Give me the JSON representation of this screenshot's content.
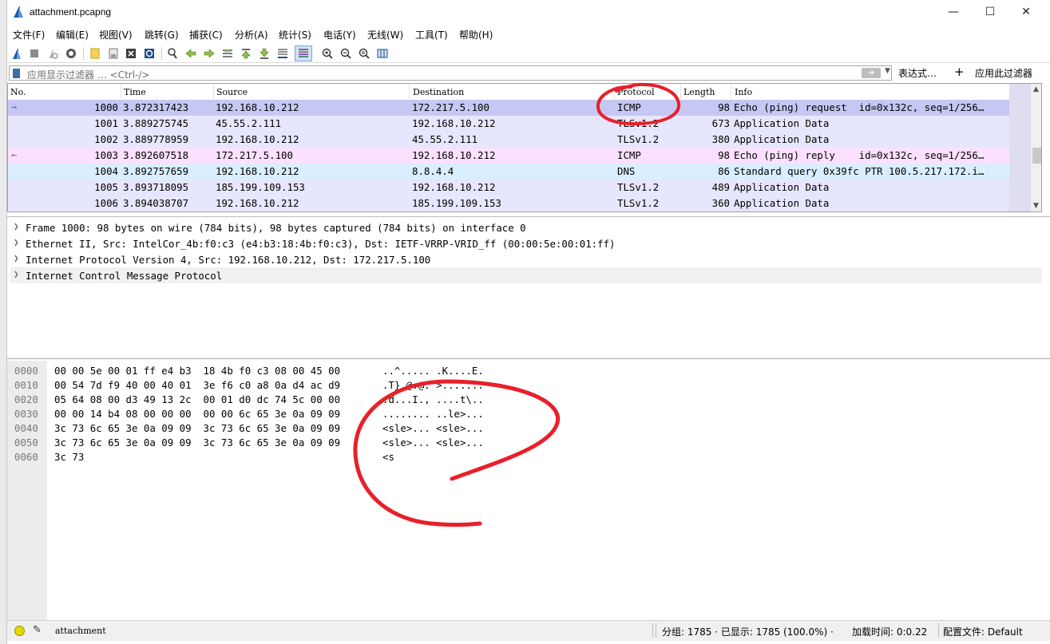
{
  "window": {
    "title": "attachment.pcapng"
  },
  "menu": [
    "文件(F)",
    "编辑(E)",
    "视图(V)",
    "跳转(G)",
    "捕获(C)",
    "分析(A)",
    "统计(S)",
    "电话(Y)",
    "无线(W)",
    "工具(T)",
    "帮助(H)"
  ],
  "filter": {
    "placeholder": "应用显示过滤器 … <Ctrl-/>",
    "expression_label": "表达式…",
    "add_label": "+",
    "apply_label": "应用此过滤器"
  },
  "packet_list": {
    "columns": [
      "No.",
      "Time",
      "Source",
      "Destination",
      "Protocol",
      "Length",
      "Info"
    ],
    "rows": [
      {
        "no": "1000",
        "time": "3.872317423",
        "source": "192.168.10.212",
        "destination": "172.217.5.100",
        "protocol": "ICMP",
        "length": "98",
        "info": "Echo (ping) request  id=0x132c, seq=1/256…",
        "marker": "→"
      },
      {
        "no": "1001",
        "time": "3.889275745",
        "source": "45.55.2.111",
        "destination": "192.168.10.212",
        "protocol": "TLSv1.2",
        "length": "673",
        "info": "Application Data",
        "marker": ""
      },
      {
        "no": "1002",
        "time": "3.889778959",
        "source": "192.168.10.212",
        "destination": "45.55.2.111",
        "protocol": "TLSv1.2",
        "length": "380",
        "info": "Application Data",
        "marker": ""
      },
      {
        "no": "1003",
        "time": "3.892607518",
        "source": "172.217.5.100",
        "destination": "192.168.10.212",
        "protocol": "ICMP",
        "length": "98",
        "info": "Echo (ping) reply    id=0x132c, seq=1/256…",
        "marker": "←"
      },
      {
        "no": "1004",
        "time": "3.892757659",
        "source": "192.168.10.212",
        "destination": "8.8.4.4",
        "protocol": "DNS",
        "length": "86",
        "info": "Standard query 0x39fc PTR 100.5.217.172.i…",
        "marker": ""
      },
      {
        "no": "1005",
        "time": "3.893718095",
        "source": "185.199.109.153",
        "destination": "192.168.10.212",
        "protocol": "TLSv1.2",
        "length": "489",
        "info": "Application Data",
        "marker": ""
      },
      {
        "no": "1006",
        "time": "3.894038707",
        "source": "192.168.10.212",
        "destination": "185.199.109.153",
        "protocol": "TLSv1.2",
        "length": "360",
        "info": "Application Data",
        "marker": ""
      }
    ],
    "row_colors": [
      "#c7c7f4",
      "#e7e6ff",
      "#e7e6ff",
      "#fce0ff",
      "#daeeff",
      "#e7e6ff",
      "#e7e6ff"
    ]
  },
  "details": [
    "Frame 1000: 98 bytes on wire (784 bits), 98 bytes captured (784 bits) on interface 0",
    "Ethernet II, Src: IntelCor_4b:f0:c3 (e4:b3:18:4b:f0:c3), Dst: IETF-VRRP-VRID_ff (00:00:5e:00:01:ff)",
    "Internet Protocol Version 4, Src: 192.168.10.212, Dst: 172.217.5.100",
    "Internet Control Message Protocol"
  ],
  "bytes": [
    {
      "offset": "0000",
      "hex": "00 00 5e 00 01 ff e4 b3  18 4b f0 c3 08 00 45 00",
      "ascii": "..^..... .K....E."
    },
    {
      "offset": "0010",
      "hex": "00 54 7d f9 40 00 40 01  3e f6 c0 a8 0a d4 ac d9",
      "ascii": ".T}.@.@. >......."
    },
    {
      "offset": "0020",
      "hex": "05 64 08 00 d3 49 13 2c  00 01 d0 dc 74 5c 00 00",
      "ascii": ".d...I., ....t\\.."
    },
    {
      "offset": "0030",
      "hex": "00 00 14 b4 08 00 00 00  00 00 6c 65 3e 0a 09 09",
      "ascii": "........ ..le>..."
    },
    {
      "offset": "0040",
      "hex": "3c 73 6c 65 3e 0a 09 09  3c 73 6c 65 3e 0a 09 09",
      "ascii": "<sle>... <sle>..."
    },
    {
      "offset": "0050",
      "hex": "3c 73 6c 65 3e 0a 09 09  3c 73 6c 65 3e 0a 09 09",
      "ascii": "<sle>... <sle>..."
    },
    {
      "offset": "0060",
      "hex": "3c 73",
      "ascii": "<s"
    }
  ],
  "status": {
    "file": "attachment",
    "stats": "分组: 1785 · 已显示: 1785 (100.0%) ·",
    "load": "加载时间: 0:0.22",
    "profile": "配置文件: Default"
  },
  "annotation_color": "#e8202a"
}
